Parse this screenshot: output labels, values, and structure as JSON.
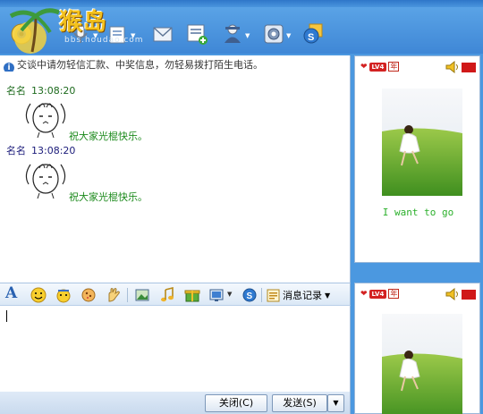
{
  "window": {
    "title": ""
  },
  "logo": {
    "text": "猴岛",
    "url": "bbs.houdao.com"
  },
  "toolbar": {
    "buttons": [
      {
        "name": "video-call-icon"
      },
      {
        "name": "voice-call-icon"
      },
      {
        "name": "file-transfer-icon"
      },
      {
        "name": "sms-icon"
      },
      {
        "name": "add-contact-icon"
      },
      {
        "name": "user-tools-icon"
      },
      {
        "name": "settings-icon"
      },
      {
        "name": "qzone-icon"
      }
    ]
  },
  "chat": {
    "notice": "交谈中请勿轻信汇款、中奖信息，勿轻易拨打陌生电话。",
    "messages": [
      {
        "name": "名名",
        "time": "13:08:20",
        "text": "祝大家光棍快乐。"
      },
      {
        "name": "名名",
        "time": "13:08:20",
        "text": "祝大家光棍快乐。"
      }
    ]
  },
  "input_toolbar": {
    "font_label": "A",
    "history_label": "消息记录"
  },
  "input": {
    "value": ""
  },
  "bottom_bar": {
    "close_label": "关闭(C)",
    "send_label": "发送(S)",
    "send_dropdown": "▼"
  },
  "right_panel": {
    "top": {
      "level": "LV4",
      "year_badge": "年",
      "caption": "I want to go"
    },
    "bottom": {
      "level": "LV4",
      "year_badge": "年"
    }
  },
  "colors": {
    "frame": "#4b98e0",
    "message_text": "#1c8a1c",
    "caption": "#2bb02b",
    "badge_red": "#d32222"
  }
}
